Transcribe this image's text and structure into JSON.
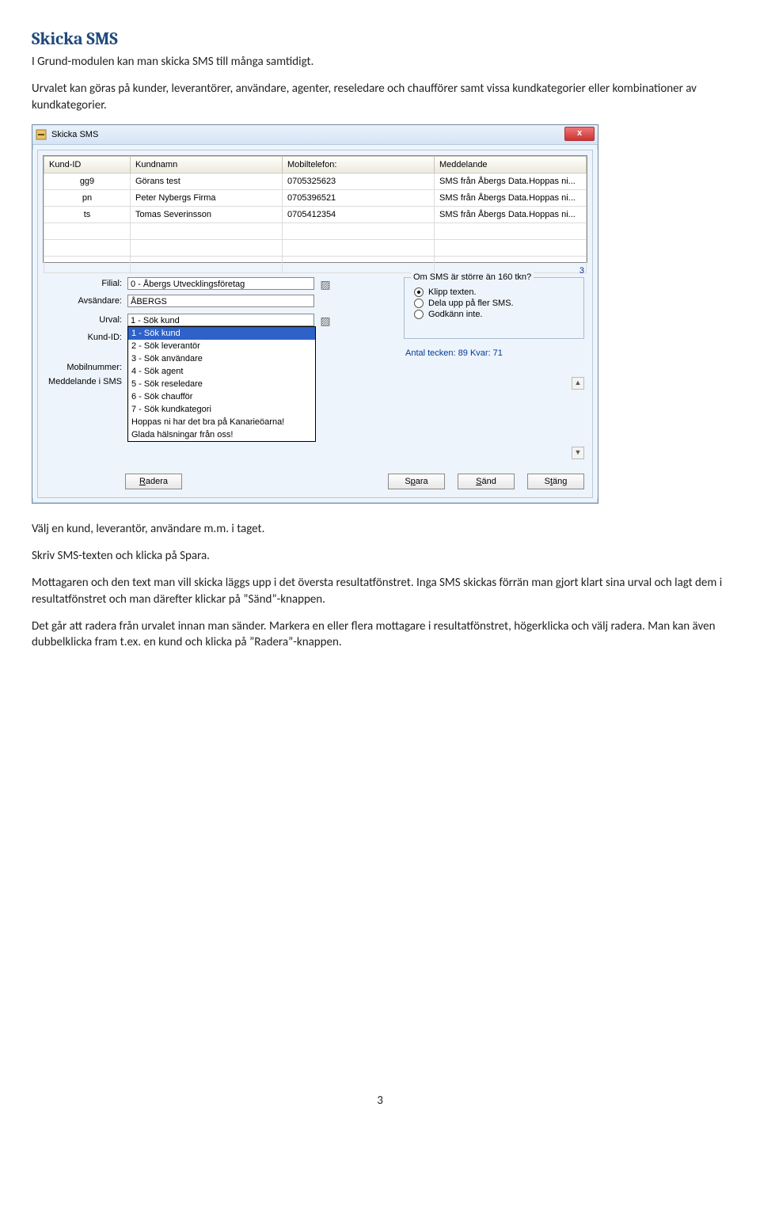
{
  "doc": {
    "title": "Skicka SMS",
    "p1": "I Grund-modulen kan man skicka SMS till många samtidigt.",
    "p2": "Urvalet kan göras på kunder, leverantörer, användare, agenter, reseledare och chaufförer samt vissa kundkategorier eller kombinationer av kundkategorier.",
    "p3": "Välj en kund, leverantör, användare m.m. i taget.",
    "p4": "Skriv SMS-texten och klicka på Spara.",
    "p5": "Mottagaren och den text man vill skicka läggs upp i det översta resultatfönstret. Inga SMS skickas förrän man gjort klart sina urval och lagt dem i resultatfönstret och man därefter klickar på ”Sänd”-knappen.",
    "p6": "Det går att radera från urvalet innan man sänder. Markera en eller flera mottagare i resultatfönstret, högerklicka och välj radera. Man kan även dubbelklicka fram t.ex. en kund och klicka på ”Radera”-knappen.",
    "page_num": "3"
  },
  "win": {
    "title": "Skicka SMS",
    "close": "x",
    "counter": "3",
    "table": {
      "headers": [
        "Kund-ID",
        "Kundnamn",
        "Mobiltelefon:",
        "Meddelande"
      ],
      "rows": [
        [
          "gg9",
          "Görans test",
          "0705325623",
          "SMS från Åbergs Data.Hoppas ni..."
        ],
        [
          "pn",
          "Peter Nybergs Firma",
          "0705396521",
          "SMS från Åbergs Data.Hoppas ni..."
        ],
        [
          "ts",
          "Tomas Severinsson",
          "0705412354",
          "SMS från Åbergs Data.Hoppas ni..."
        ]
      ]
    },
    "form": {
      "filial_lbl": "Filial:",
      "filial_val": "0     - Åbergs Utvecklingsföretag",
      "avs_lbl": "Avsändare:",
      "avs_val": "ÅBERGS",
      "urval_lbl": "Urval:",
      "urval_val": "1 - Sök kund",
      "kundid_lbl": "Kund-ID:",
      "mobil_lbl": "Mobilnummer:",
      "medd_lbl": "Meddelande i SMS"
    },
    "dropdown": {
      "items": [
        "1  - Sök kund",
        "2  - Sök leverantör",
        "3  - Sök användare",
        "4  - Sök agent",
        "5  - Sök reseledare",
        "6  - Sök chaufför",
        "7  - Sök kundkategori"
      ],
      "extra1": "Hoppas ni har det bra på Kanarieöarna!",
      "extra2": "Glada hälsningar från oss!"
    },
    "group": {
      "legend": "Om SMS är större än 160 tkn?",
      "r1": "Klipp texten.",
      "r2": "Dela upp på fler SMS.",
      "r3": "Godkänn inte."
    },
    "antal": "Antal tecken: 89 Kvar: 71",
    "buttons": {
      "radera": "Radera",
      "spara": "Spara",
      "sand": "Sänd",
      "stang": "Stäng"
    }
  }
}
